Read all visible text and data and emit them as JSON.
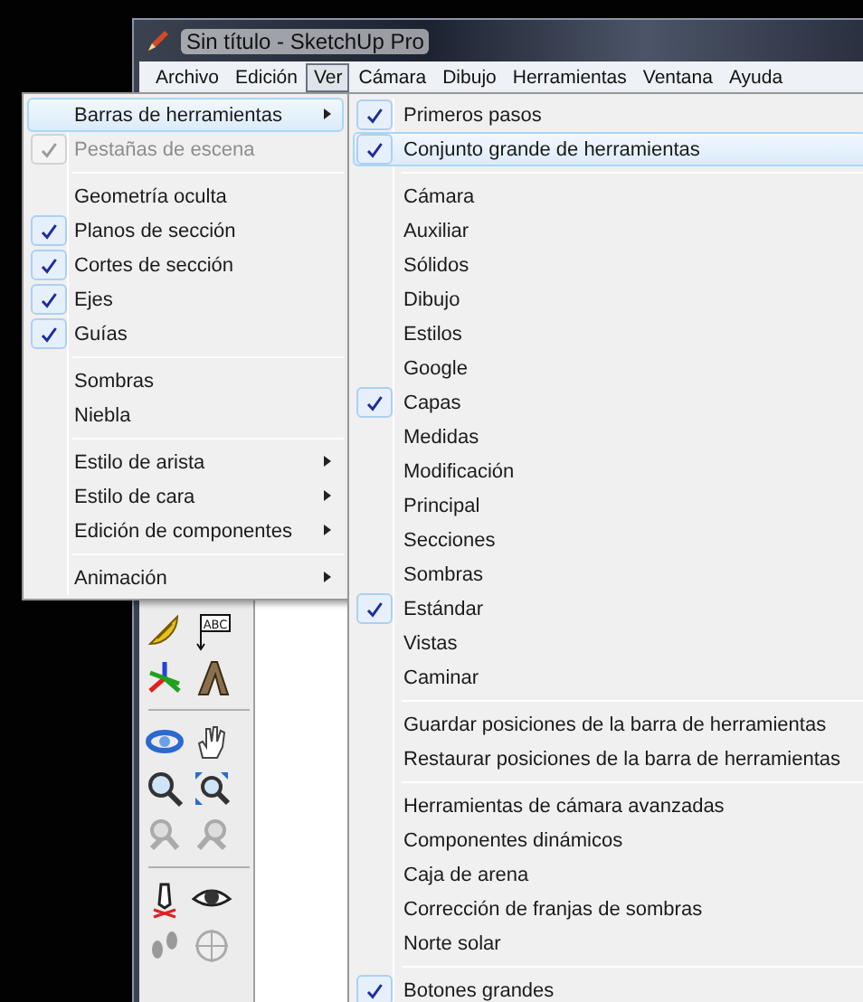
{
  "window": {
    "title": "Sin título - SketchUp Pro"
  },
  "menu_bar": [
    {
      "label": "Archivo",
      "selected": false
    },
    {
      "label": "Edición",
      "selected": false
    },
    {
      "label": "Ver",
      "selected": true
    },
    {
      "label": "Cámara",
      "selected": false
    },
    {
      "label": "Dibujo",
      "selected": false
    },
    {
      "label": "Herramientas",
      "selected": false
    },
    {
      "label": "Ventana",
      "selected": false
    },
    {
      "label": "Ayuda",
      "selected": false
    }
  ],
  "view_menu": [
    {
      "kind": "item",
      "label": "Barras de herramientas",
      "checked": false,
      "disabled": false,
      "submenu": true,
      "highlighted": true
    },
    {
      "kind": "item",
      "label": "Pestañas de escena",
      "checked": true,
      "disabled": true,
      "submenu": false,
      "highlighted": false
    },
    {
      "kind": "separator"
    },
    {
      "kind": "item",
      "label": "Geometría oculta",
      "checked": false,
      "disabled": false,
      "submenu": false,
      "highlighted": false
    },
    {
      "kind": "item",
      "label": "Planos de sección",
      "checked": true,
      "disabled": false,
      "submenu": false,
      "highlighted": false
    },
    {
      "kind": "item",
      "label": "Cortes de sección",
      "checked": true,
      "disabled": false,
      "submenu": false,
      "highlighted": false
    },
    {
      "kind": "item",
      "label": "Ejes",
      "checked": true,
      "disabled": false,
      "submenu": false,
      "highlighted": false
    },
    {
      "kind": "item",
      "label": "Guías",
      "checked": true,
      "disabled": false,
      "submenu": false,
      "highlighted": false
    },
    {
      "kind": "separator"
    },
    {
      "kind": "item",
      "label": "Sombras",
      "checked": false,
      "disabled": false,
      "submenu": false,
      "highlighted": false
    },
    {
      "kind": "item",
      "label": "Niebla",
      "checked": false,
      "disabled": false,
      "submenu": false,
      "highlighted": false
    },
    {
      "kind": "separator"
    },
    {
      "kind": "item",
      "label": "Estilo de arista",
      "checked": false,
      "disabled": false,
      "submenu": true,
      "highlighted": false
    },
    {
      "kind": "item",
      "label": "Estilo de cara",
      "checked": false,
      "disabled": false,
      "submenu": true,
      "highlighted": false
    },
    {
      "kind": "item",
      "label": "Edición de componentes",
      "checked": false,
      "disabled": false,
      "submenu": true,
      "highlighted": false
    },
    {
      "kind": "separator"
    },
    {
      "kind": "item",
      "label": "Animación",
      "checked": false,
      "disabled": false,
      "submenu": true,
      "highlighted": false
    }
  ],
  "toolbars_submenu": [
    {
      "kind": "item",
      "label": "Primeros pasos",
      "checked": true,
      "highlighted": false
    },
    {
      "kind": "item",
      "label": "Conjunto grande de herramientas",
      "checked": true,
      "highlighted": true
    },
    {
      "kind": "separator"
    },
    {
      "kind": "item",
      "label": "Cámara",
      "checked": false,
      "highlighted": false
    },
    {
      "kind": "item",
      "label": "Auxiliar",
      "checked": false,
      "highlighted": false
    },
    {
      "kind": "item",
      "label": "Sólidos",
      "checked": false,
      "highlighted": false
    },
    {
      "kind": "item",
      "label": "Dibujo",
      "checked": false,
      "highlighted": false
    },
    {
      "kind": "item",
      "label": "Estilos",
      "checked": false,
      "highlighted": false
    },
    {
      "kind": "item",
      "label": "Google",
      "checked": false,
      "highlighted": false
    },
    {
      "kind": "item",
      "label": "Capas",
      "checked": true,
      "highlighted": false
    },
    {
      "kind": "item",
      "label": "Medidas",
      "checked": false,
      "highlighted": false
    },
    {
      "kind": "item",
      "label": "Modificación",
      "checked": false,
      "highlighted": false
    },
    {
      "kind": "item",
      "label": "Principal",
      "checked": false,
      "highlighted": false
    },
    {
      "kind": "item",
      "label": "Secciones",
      "checked": false,
      "highlighted": false
    },
    {
      "kind": "item",
      "label": "Sombras",
      "checked": false,
      "highlighted": false
    },
    {
      "kind": "item",
      "label": "Estándar",
      "checked": true,
      "highlighted": false
    },
    {
      "kind": "item",
      "label": "Vistas",
      "checked": false,
      "highlighted": false
    },
    {
      "kind": "item",
      "label": "Caminar",
      "checked": false,
      "highlighted": false
    },
    {
      "kind": "separator"
    },
    {
      "kind": "item",
      "label": "Guardar posiciones de la barra de herramientas",
      "checked": false,
      "highlighted": false
    },
    {
      "kind": "item",
      "label": "Restaurar posiciones de la barra de herramientas",
      "checked": false,
      "highlighted": false
    },
    {
      "kind": "separator"
    },
    {
      "kind": "item",
      "label": "Herramientas de cámara avanzadas",
      "checked": false,
      "highlighted": false
    },
    {
      "kind": "item",
      "label": "Componentes dinámicos",
      "checked": false,
      "highlighted": false
    },
    {
      "kind": "item",
      "label": "Caja de arena",
      "checked": false,
      "highlighted": false
    },
    {
      "kind": "item",
      "label": "Corrección de franjas de sombras",
      "checked": false,
      "highlighted": false
    },
    {
      "kind": "item",
      "label": "Norte solar",
      "checked": false,
      "highlighted": false
    },
    {
      "kind": "separator"
    },
    {
      "kind": "item",
      "label": "Botones grandes",
      "checked": true,
      "highlighted": false
    }
  ],
  "tool_palette": {
    "text_tool_label": "ABC"
  }
}
